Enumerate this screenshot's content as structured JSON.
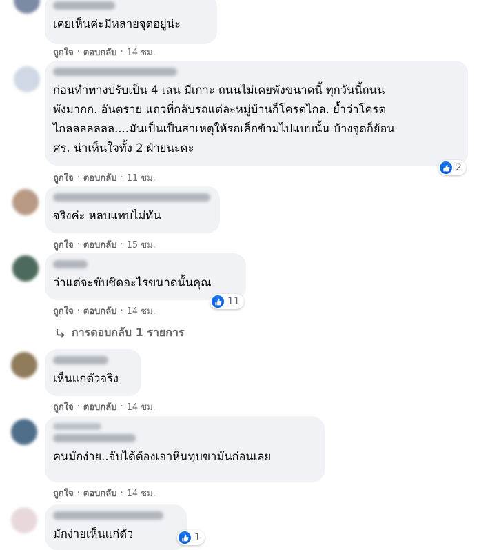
{
  "comments": [
    {
      "text": "เคยเห็นค่ะมีหลายจุดอยู่น่ะ",
      "like": "ถูกใจ",
      "reply": "ตอบกลับ",
      "time": "14 ชม."
    },
    {
      "text": "ก่อนทำทางปรับเป็น 4 เลน มีเกาะ ถนนไม่เคยพังขนาดนี้ ทุกวันนี้ถนน\nพังมากก. อันตราย แถวที่กลับรถแต่ละหมู่บ้านก็โครตไกล. ย้ำว่าโครต\nไกลลลลลลล....มันเป็นเป็นสาเหตุให้รถเล็กข้ามไปแบบนั้น บ้างจุดก็ย้อน\nศร. น่าเห็นใจทั้ง 2 ฝ่ายนะคะ",
      "like": "ถูกใจ",
      "reply": "ตอบกลับ",
      "time": "11 ชม.",
      "reactions": "2"
    },
    {
      "text": "จริงค่ะ หลบแทบไม่ทัน",
      "like": "ถูกใจ",
      "reply": "ตอบกลับ",
      "time": "15 ชม."
    },
    {
      "text": "ว่าแต่จะขับชิดอะไรขนาดนั้นคุณ",
      "like": "ถูกใจ",
      "reply": "ตอบกลับ",
      "time": "14 ชม.",
      "reactions": "11"
    },
    {
      "text": "เห็นแก่ตัวจริง",
      "like": "ถูกใจ",
      "reply": "ตอบกลับ",
      "time": "14 ชม."
    },
    {
      "text": "คนมักง่าย..จับได้ต้องเอาหินทุบขามันก่อนเลย",
      "like": "ถูกใจ",
      "reply": "ตอบกลับ",
      "time": "14 ชม."
    },
    {
      "text": "มักง่ายเห็นแก่ตัว",
      "reactions": "1"
    }
  ],
  "replies_link": "การตอบกลับ 1 รายการ",
  "separator": "·",
  "colors": {
    "accent": "#1877f2",
    "bubble": "#f0f2f5",
    "meta": "#65676b"
  }
}
